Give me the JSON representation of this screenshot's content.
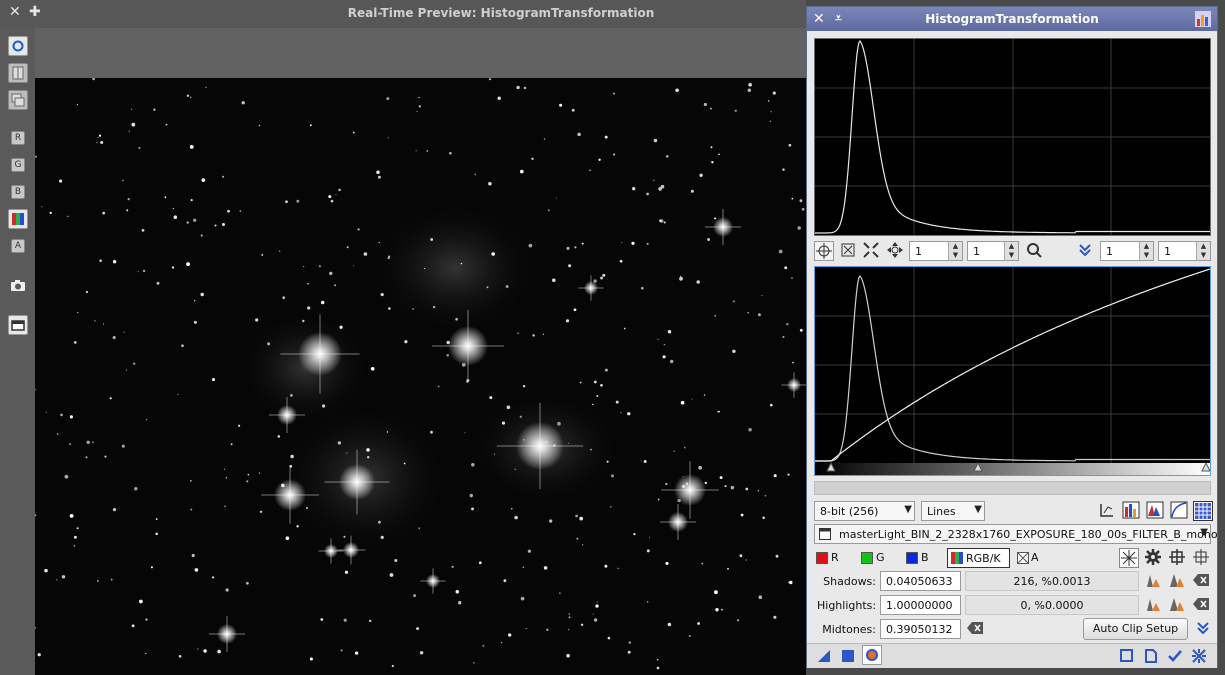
{
  "preview": {
    "title": "Real-Time Preview: HistogramTransformation",
    "close_glyph": "✕",
    "add_glyph": "✚",
    "toolbar": {
      "channel_r": "R",
      "channel_g": "G",
      "channel_b": "B",
      "channel_a": "A"
    }
  },
  "dialog": {
    "title": "HistogramTransformation",
    "close_glyph": "✕",
    "shade_glyph": "⩡",
    "zoom_x": "1",
    "zoom_y": "1",
    "zoom_x2": "1",
    "zoom_y2": "1",
    "resolution": "8-bit (256)",
    "graph_style": "Lines",
    "view_name": "masterLight_BIN_2_2328x1760_EXPOSURE_180_00s_FILTER_B_mono",
    "channels": {
      "r": "R",
      "g": "G",
      "b": "B",
      "rgbk": "RGB/K",
      "a": "A"
    },
    "shadows_label": "Shadows:",
    "shadows_value": "0.04050633",
    "shadows_clip": "216, %0.0013",
    "highlights_label": "Highlights:",
    "highlights_value": "1.00000000",
    "highlights_clip": "0, %0.0000",
    "midtones_label": "Midtones:",
    "midtones_value": "0.39050132",
    "auto_clip_label": "Auto Clip Setup"
  },
  "colors": {
    "title_bar": "#5e6aa0",
    "accent_blue": "#2a57c2",
    "red": "#e0101a",
    "green": "#12c41a",
    "blue": "#0a28d8"
  }
}
